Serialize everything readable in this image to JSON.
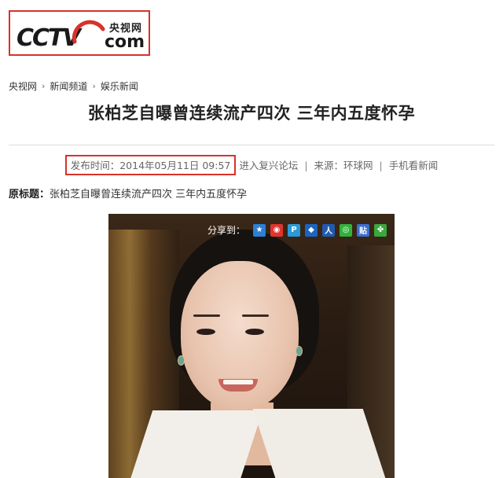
{
  "logo": {
    "wordmark": "CCTV",
    "cn_name": "央视网",
    "domain": "com",
    "accent_color": "#d8322a"
  },
  "breadcrumb": {
    "items": [
      "央视网",
      "新闻频道",
      "娱乐新闻"
    ],
    "separator": "›"
  },
  "article": {
    "title": "张柏芝自曝曾连续流产四次  三年内五度怀孕",
    "publish_time": "发布时间：2014年05月11日 09:57",
    "forum_link": "进入复兴论坛",
    "source": "来源：环球网",
    "mobile_link": "手机看新闻",
    "orig_label": "原标题：",
    "orig_title": "张柏芝自曝曾连续流产四次 三年内五度怀孕"
  },
  "share": {
    "label": "分享到：",
    "icons": [
      {
        "name": "qzone-icon",
        "glyph": "★",
        "color": "#2b7fd6"
      },
      {
        "name": "weibo-icon",
        "glyph": "◉",
        "color": "#e0342c"
      },
      {
        "name": "qqweibo-icon",
        "glyph": "P",
        "color": "#2a9ad8"
      },
      {
        "name": "qq-icon",
        "glyph": "◆",
        "color": "#1d64c2"
      },
      {
        "name": "renren-icon",
        "glyph": "人",
        "color": "#1f5bb0"
      },
      {
        "name": "wechat-icon",
        "glyph": "◎",
        "color": "#32b13a"
      },
      {
        "name": "tieba-icon",
        "glyph": "贴",
        "color": "#3b6fd0"
      },
      {
        "name": "clover-icon",
        "glyph": "✤",
        "color": "#38a83c"
      }
    ]
  }
}
